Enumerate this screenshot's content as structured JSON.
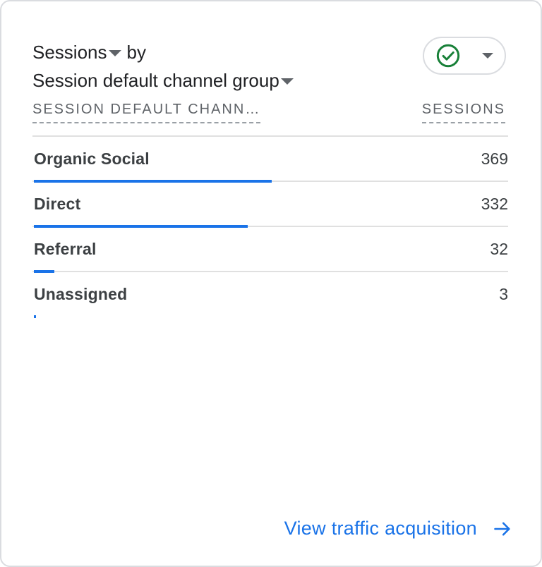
{
  "card": {
    "metric_label": "Sessions",
    "by_label": "by",
    "dimension_label": "Session default channel group"
  },
  "status": {
    "icon": "check-circle-icon",
    "color": "#188038"
  },
  "table": {
    "columns": [
      "SESSION DEFAULT CHANN…",
      "SESSIONS"
    ],
    "max_value": 369,
    "rows": [
      {
        "label": "Organic Social",
        "value": "369",
        "bar_value": 369
      },
      {
        "label": "Direct",
        "value": "332",
        "bar_value": 332
      },
      {
        "label": "Referral",
        "value": "32",
        "bar_value": 32
      },
      {
        "label": "Unassigned",
        "value": "3",
        "bar_value": 3
      }
    ]
  },
  "footer": {
    "link_label": "View traffic acquisition",
    "icon": "arrow-right-icon"
  },
  "colors": {
    "accent": "#1a73e8",
    "text": "#202124",
    "muted": "#5f6368",
    "divider": "#e0e0e0"
  }
}
